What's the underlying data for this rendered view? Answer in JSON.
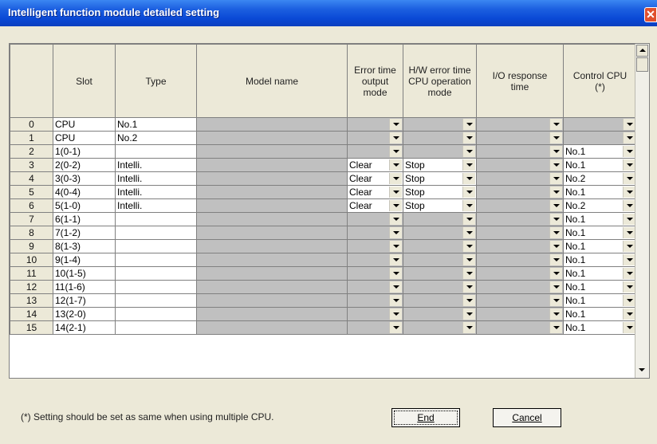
{
  "window": {
    "title": "Intelligent function module detailed setting"
  },
  "table": {
    "headers": [
      "",
      "Slot",
      "Type",
      "Model name",
      "Error time\noutput\nmode",
      "H/W error time\nCPU operation\nmode",
      "I/O response\ntime",
      "Control CPU\n(*)"
    ],
    "rows": [
      {
        "no": "0",
        "slot": "CPU",
        "type": "No.1",
        "model": "",
        "err": "",
        "hw": "",
        "io": "",
        "cpu": ""
      },
      {
        "no": "1",
        "slot": "CPU",
        "type": "No.2",
        "model": "",
        "err": "",
        "hw": "",
        "io": "",
        "cpu": ""
      },
      {
        "no": "2",
        "slot": "1(0-1)",
        "type": "",
        "model": "",
        "err": "",
        "hw": "",
        "io": "",
        "cpu": "No.1"
      },
      {
        "no": "3",
        "slot": "2(0-2)",
        "type": "Intelli.",
        "model": "",
        "err": "Clear",
        "hw": "Stop",
        "io": "",
        "cpu": "No.1"
      },
      {
        "no": "4",
        "slot": "3(0-3)",
        "type": "Intelli.",
        "model": "",
        "err": "Clear",
        "hw": "Stop",
        "io": "",
        "cpu": "No.2"
      },
      {
        "no": "5",
        "slot": "4(0-4)",
        "type": "Intelli.",
        "model": "",
        "err": "Clear",
        "hw": "Stop",
        "io": "",
        "cpu": "No.1"
      },
      {
        "no": "6",
        "slot": "5(1-0)",
        "type": "Intelli.",
        "model": "",
        "err": "Clear",
        "hw": "Stop",
        "io": "",
        "cpu": "No.2"
      },
      {
        "no": "7",
        "slot": "6(1-1)",
        "type": "",
        "model": "",
        "err": "",
        "hw": "",
        "io": "",
        "cpu": "No.1"
      },
      {
        "no": "8",
        "slot": "7(1-2)",
        "type": "",
        "model": "",
        "err": "",
        "hw": "",
        "io": "",
        "cpu": "No.1"
      },
      {
        "no": "9",
        "slot": "8(1-3)",
        "type": "",
        "model": "",
        "err": "",
        "hw": "",
        "io": "",
        "cpu": "No.1"
      },
      {
        "no": "10",
        "slot": "9(1-4)",
        "type": "",
        "model": "",
        "err": "",
        "hw": "",
        "io": "",
        "cpu": "No.1"
      },
      {
        "no": "11",
        "slot": "10(1-5)",
        "type": "",
        "model": "",
        "err": "",
        "hw": "",
        "io": "",
        "cpu": "No.1"
      },
      {
        "no": "12",
        "slot": "11(1-6)",
        "type": "",
        "model": "",
        "err": "",
        "hw": "",
        "io": "",
        "cpu": "No.1"
      },
      {
        "no": "13",
        "slot": "12(1-7)",
        "type": "",
        "model": "",
        "err": "",
        "hw": "",
        "io": "",
        "cpu": "No.1"
      },
      {
        "no": "14",
        "slot": "13(2-0)",
        "type": "",
        "model": "",
        "err": "",
        "hw": "",
        "io": "",
        "cpu": "No.1"
      },
      {
        "no": "15",
        "slot": "14(2-1)",
        "type": "",
        "model": "",
        "err": "",
        "hw": "",
        "io": "",
        "cpu": "No.1"
      }
    ]
  },
  "footer": {
    "note": "(*) Setting should be set as same when using multiple CPU.",
    "end_label": "End",
    "cancel_label": "Cancel"
  }
}
